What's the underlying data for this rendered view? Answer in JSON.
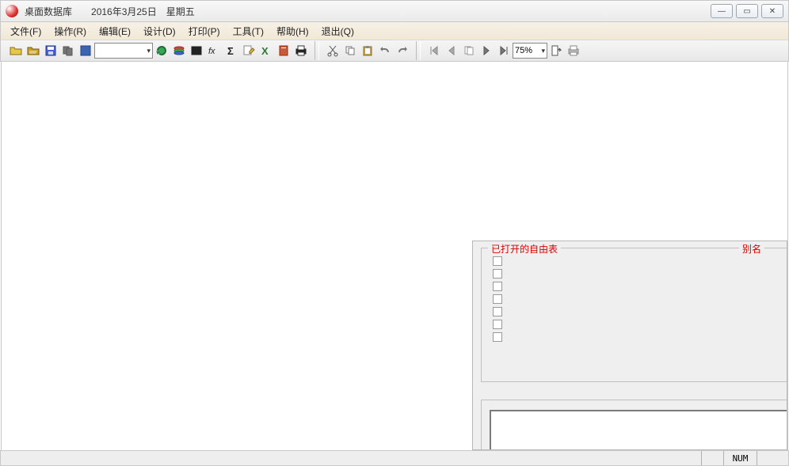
{
  "titlebar": {
    "app_name": "桌面数据库",
    "date": "2016年3月25日",
    "day_of_week": "星期五"
  },
  "window_controls": {
    "minimize": "—",
    "maximize": "▭",
    "close": "✕"
  },
  "menu": {
    "file": "文件(F)",
    "operate": "操作(R)",
    "edit": "编辑(E)",
    "design": "设计(D)",
    "print": "打印(P)",
    "tools": "工具(T)",
    "help": "帮助(H)",
    "exit": "退出(Q)"
  },
  "toolbar": {
    "selector_value": "",
    "zoom_value": "75%"
  },
  "panel": {
    "opened_tables_label": "已打开的自由表",
    "alias_label": "别名",
    "check_count": 7
  },
  "status": {
    "num": "NUM"
  }
}
